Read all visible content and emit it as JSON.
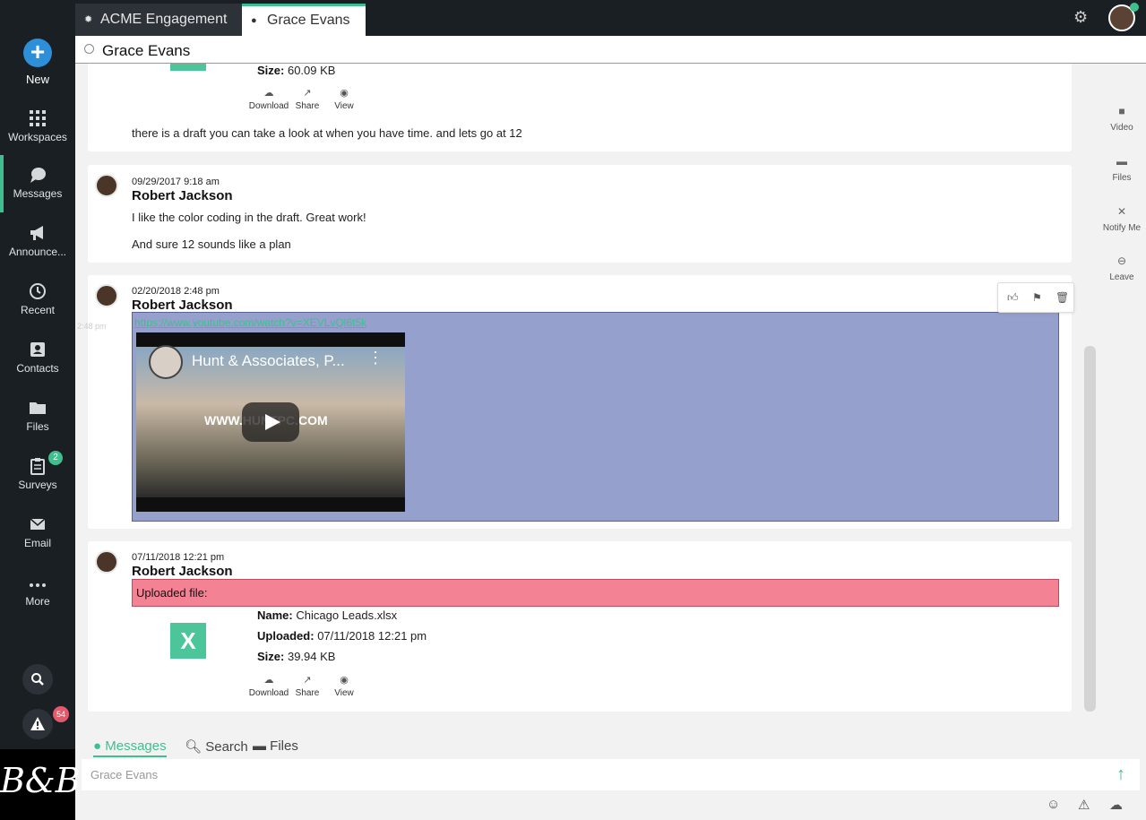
{
  "sidebar": {
    "new_label": "New",
    "items": [
      {
        "label": "Workspaces",
        "icon": "grid-icon"
      },
      {
        "label": "Messages",
        "icon": "chat-icon"
      },
      {
        "label": "Announce...",
        "icon": "megaphone-icon"
      },
      {
        "label": "Recent",
        "icon": "history-icon"
      },
      {
        "label": "Contacts",
        "icon": "contacts-icon"
      },
      {
        "label": "Files",
        "icon": "folder-icon"
      },
      {
        "label": "Surveys",
        "icon": "clipboard-icon"
      },
      {
        "label": "Email",
        "icon": "envelope-icon"
      },
      {
        "label": "More",
        "icon": "more-dots-icon"
      }
    ],
    "surveys_badge": "2",
    "alerts_badge": "54",
    "logo_text": "B&B"
  },
  "tabs": [
    {
      "label": "ACME Engagement"
    },
    {
      "label": "Grace Evans"
    }
  ],
  "header": {
    "title": "Grace Evans"
  },
  "messages": {
    "m0": {
      "size_label": "Size:",
      "size_value": "60.09 KB",
      "download": "Download",
      "share": "Share",
      "view": "View",
      "text": "there is a draft you can take a look at when you have time. and lets go at 12"
    },
    "m1": {
      "time": "09/29/2017 9:18 am",
      "author": "Robert Jackson",
      "line1": "I like the color coding in the draft. Great work!",
      "line2": "And sure 12 sounds like a plan"
    },
    "m2": {
      "time": "02/20/2018 2:48 pm",
      "side_time": "2:48 pm",
      "author": "Robert Jackson",
      "link": "https://www.youtube.com/watch?v=XEVLvQl6t5k",
      "video_title": "Hunt & Associates, P...",
      "video_watermark": "WWW.HUNTPC.COM"
    },
    "m3": {
      "time": "07/11/2018 12:21 pm",
      "author": "Robert Jackson",
      "uploaded_text": "Uploaded file:",
      "name_label": "Name:",
      "name_value": "Chicago Leads.xlsx",
      "uploaded_label": "Uploaded:",
      "uploaded_value": "07/11/2018 12:21 pm",
      "size_label": "Size:",
      "size_value": "39.94 KB",
      "download": "Download",
      "share": "Share",
      "view": "View",
      "file_icon_letter": "X"
    }
  },
  "rail": {
    "video": "Video",
    "files": "Files",
    "notify": "Notify Me",
    "leave": "Leave"
  },
  "bottom_tabs": {
    "messages": "Messages",
    "search": "Search",
    "files": "Files"
  },
  "composer": {
    "placeholder": "Grace Evans"
  },
  "colors": {
    "accent": "#3fbf8f",
    "sidebar": "#1a1f24",
    "highlight_blue": "#96a0cc",
    "highlight_red": "#f38295"
  }
}
